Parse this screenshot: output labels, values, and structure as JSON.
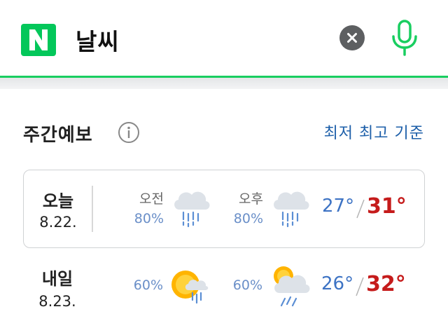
{
  "search": {
    "logo": "N",
    "query": "날씨",
    "clear_icon": "close-icon",
    "mic_icon": "microphone-icon"
  },
  "weekly": {
    "title": "주간예보",
    "sort_label": "최저 최고 기준",
    "days": [
      {
        "name": "오늘",
        "date": "8.22.",
        "am": {
          "label": "오전",
          "rain": "80%",
          "icon": "rain-icon"
        },
        "pm": {
          "label": "오후",
          "rain": "80%",
          "icon": "rain-icon"
        },
        "low": "27°",
        "high": "31°"
      },
      {
        "name": "내일",
        "date": "8.23.",
        "am": {
          "label": "",
          "rain": "60%",
          "icon": "sun-shower-icon"
        },
        "pm": {
          "label": "",
          "rain": "60%",
          "icon": "thunder-rain-icon"
        },
        "low": "26°",
        "high": "32°"
      }
    ]
  },
  "colors": {
    "brand_green": "#03c75a",
    "accent_blue": "#1d5fa9",
    "low_temp": "#3d73c4",
    "high_temp": "#c51b1b",
    "rain_prob": "#6a8fc8"
  }
}
